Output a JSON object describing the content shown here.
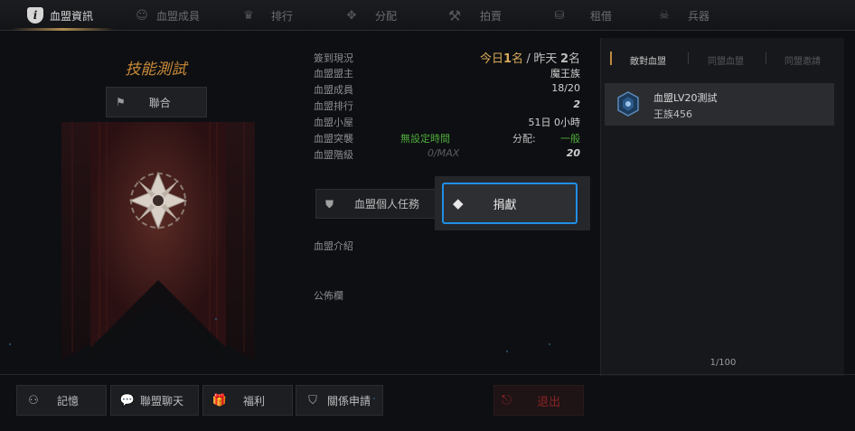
{
  "tabs": [
    {
      "label": "血盟資訊",
      "icon": "info-shield-icon",
      "glyph": "i",
      "active": true
    },
    {
      "label": "血盟成員",
      "icon": "members-icon",
      "glyph": "☺",
      "active": false
    },
    {
      "label": "排行",
      "icon": "rank-icon",
      "glyph": "♛",
      "active": false
    },
    {
      "label": "分配",
      "icon": "distribute-icon",
      "glyph": "✥",
      "active": false
    },
    {
      "label": "拍賣",
      "icon": "auction-hammer-icon",
      "glyph": "⚒",
      "active": false
    },
    {
      "label": "租借",
      "icon": "rent-coins-icon",
      "glyph": "⛁",
      "active": false
    },
    {
      "label": "兵器",
      "icon": "weapon-icon",
      "glyph": "☠",
      "active": false
    }
  ],
  "left": {
    "skill_title": "技能測試",
    "union_label": "聯合"
  },
  "info": {
    "checkin_label": "簽到現況",
    "today_prefix": "今日",
    "today_count": "1",
    "today_suffix": "名",
    "separator": "/",
    "yesterday_prefix": "昨天",
    "yesterday_count": "2",
    "yesterday_suffix": "名",
    "leader_label": "血盟盟主",
    "leader_value": "魔王族",
    "members_label": "血盟成員",
    "members_value": "18/20",
    "rank_label": "血盟排行",
    "rank_value": "2",
    "house_label": "血盟小屋",
    "house_value": "51日 0小時",
    "raid_label": "血盟突襲",
    "raid_value": "無設定時間",
    "distribution_label": "分配:",
    "distribution_value": "一般",
    "level_label": "血盟階級",
    "level_max": "0/MAX",
    "level_value": "20"
  },
  "buttons": {
    "mission": "血盟個人任務",
    "donate": "捐獻"
  },
  "sections": {
    "intro": "血盟介紹",
    "notice": "公佈欄"
  },
  "right": {
    "tabs": [
      "敵對血盟",
      "同盟血盟",
      "同盟邀請"
    ],
    "enemy_name": "血盟LV20測試",
    "enemy_sub": "王族456",
    "page_count": "1/100"
  },
  "bottom": {
    "record": "記憶",
    "alliance_chat": "聯盟聊天",
    "welfare": "福利",
    "relation_request": "關係申請",
    "exit": "退出"
  },
  "colors": {
    "accent_gold": "#c88a38",
    "highlight_blue": "#1f8fe6",
    "positive_green": "#4faa3c",
    "exit_red": "#8a2424"
  }
}
